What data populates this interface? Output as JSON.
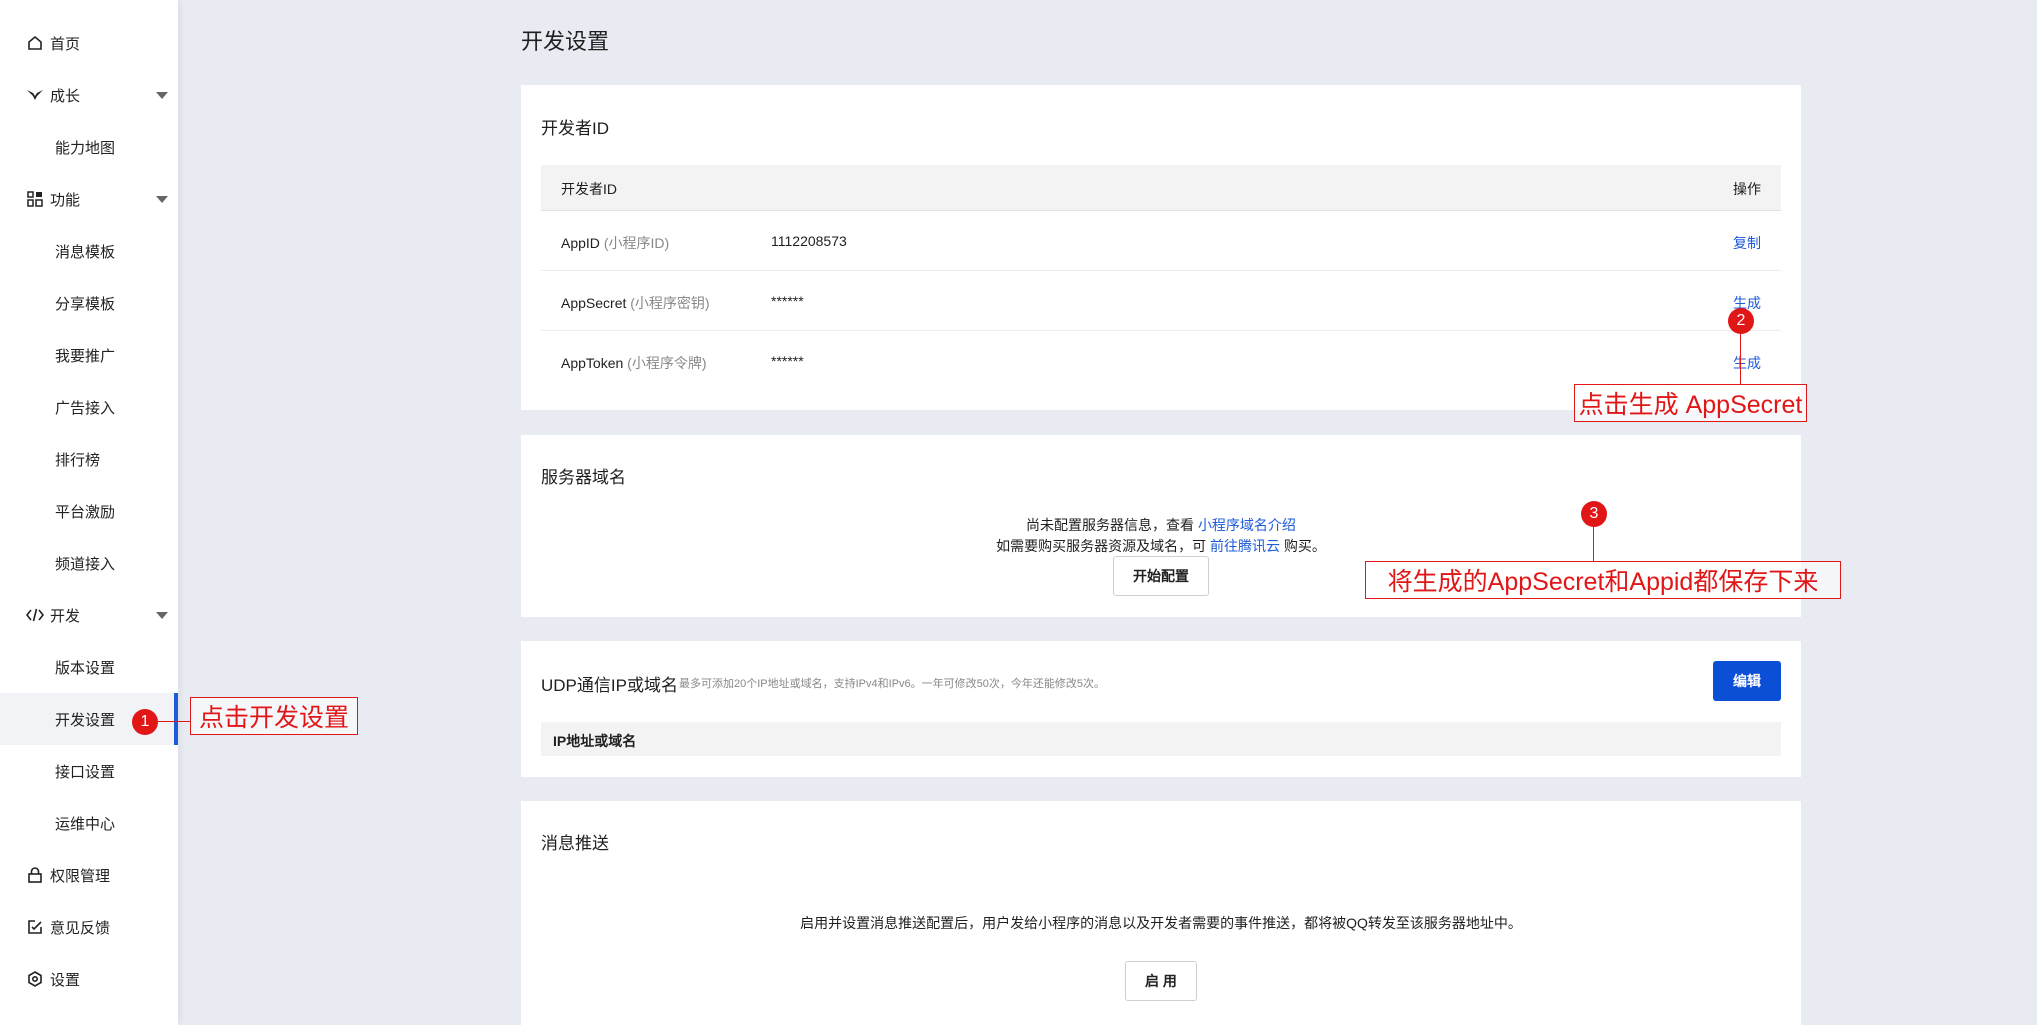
{
  "sidebar": {
    "items": [
      {
        "label": "首页",
        "icon": "home-icon"
      },
      {
        "label": "成长",
        "icon": "growth-icon"
      },
      {
        "label": "能力地图"
      },
      {
        "label": "功能",
        "icon": "grid-icon"
      },
      {
        "label": "消息模板"
      },
      {
        "label": "分享模板"
      },
      {
        "label": "我要推广"
      },
      {
        "label": "广告接入"
      },
      {
        "label": "排行榜"
      },
      {
        "label": "平台激励"
      },
      {
        "label": "频道接入"
      },
      {
        "label": "开发",
        "icon": "code-icon"
      },
      {
        "label": "版本设置"
      },
      {
        "label": "开发设置"
      },
      {
        "label": "接口设置"
      },
      {
        "label": "运维中心"
      },
      {
        "label": "权限管理",
        "icon": "lock-icon"
      },
      {
        "label": "意见反馈",
        "icon": "feedback-icon"
      },
      {
        "label": "设置",
        "icon": "settings-icon"
      }
    ]
  },
  "main": {
    "page_title": "开发设置",
    "developer_id": {
      "title": "开发者ID",
      "col_name": "开发者ID",
      "col_action": "操作",
      "rows": [
        {
          "name": "AppID",
          "hint": "(小程序ID)",
          "value": "1112208573",
          "action": "复制"
        },
        {
          "name": "AppSecret",
          "hint": "(小程序密钥)",
          "value": "******",
          "action": "生成"
        },
        {
          "name": "AppToken",
          "hint": "(小程序令牌)",
          "value": "******",
          "action": "生成"
        }
      ]
    },
    "server_domain": {
      "title": "服务器域名",
      "line1_text": "尚未配置服务器信息，查看",
      "line1_link": "小程序域名介绍",
      "line2_text": "如需要购买服务器资源及域名，可",
      "line2_link": "前往腾讯云",
      "line2_suffix": "购买。",
      "button": "开始配置"
    },
    "udp": {
      "title": "UDP通信IP或域名",
      "note": "最多可添加20个IP地址或域名，支持IPv4和IPv6。一年可修改50次，今年还能修改5次。",
      "button": "编辑",
      "col": "IP地址或域名"
    },
    "push": {
      "title": "消息推送",
      "desc": "启用并设置消息推送配置后，用户发给小程序的消息以及开发者需要的事件推送，都将被QQ转发至该服务器地址中。",
      "button": "启 用"
    }
  },
  "annotations": [
    {
      "num": "1",
      "text": "点击开发设置"
    },
    {
      "num": "2",
      "text": "点击生成 AppSecret"
    },
    {
      "num": "3",
      "text": "将生成的AppSecret和Appid都保存下来"
    }
  ],
  "colors": {
    "accent": "#1e5bd8",
    "primary_button": "#0b4fd6",
    "annotation": "#e11616",
    "background": "#e8ebf2"
  }
}
